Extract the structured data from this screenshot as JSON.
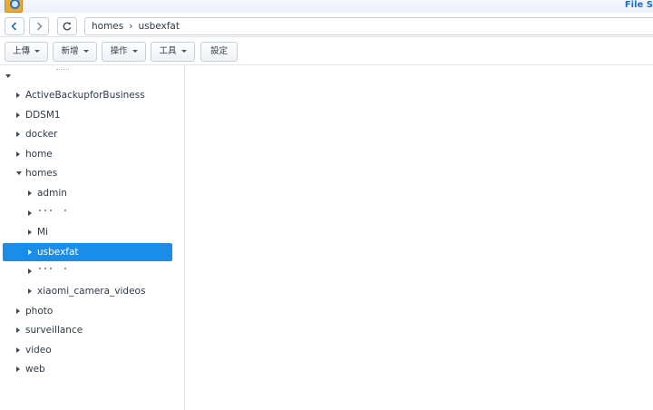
{
  "app": {
    "title": "File S"
  },
  "nav": {
    "back_icon": "chevron-left-icon",
    "forward_icon": "chevron-right-icon",
    "refresh_icon": "refresh-icon",
    "breadcrumb": [
      "homes",
      "usbexfat"
    ],
    "separator": "›"
  },
  "toolbar": {
    "upload_label": "上傳",
    "create_label": "新增",
    "action_label": "操作",
    "tools_label": "工具",
    "settings_label": "設定"
  },
  "tree": {
    "items": [
      {
        "label": "ActiveBackupforBusiness",
        "level": 1,
        "expanded": false
      },
      {
        "label": "DDSM1",
        "level": 1,
        "expanded": false
      },
      {
        "label": "docker",
        "level": 1,
        "expanded": false
      },
      {
        "label": "home",
        "level": 1,
        "expanded": false
      },
      {
        "label": "homes",
        "level": 1,
        "expanded": true
      },
      {
        "label": "admin",
        "level": 2,
        "expanded": false
      },
      {
        "label": "",
        "level": 2,
        "expanded": false,
        "obscured": true
      },
      {
        "label": "Mi",
        "level": 2,
        "expanded": false
      },
      {
        "label": "usbexfat",
        "level": 2,
        "expanded": false,
        "selected": true
      },
      {
        "label": "",
        "level": 2,
        "expanded": false,
        "obscured": true
      },
      {
        "label": "xiaomi_camera_videos",
        "level": 2,
        "expanded": false
      },
      {
        "label": "photo",
        "level": 1,
        "expanded": false
      },
      {
        "label": "surveillance",
        "level": 1,
        "expanded": false
      },
      {
        "label": "video",
        "level": 1,
        "expanded": false
      },
      {
        "label": "web",
        "level": 1,
        "expanded": false
      }
    ]
  },
  "colors": {
    "accent": "#1a8de8",
    "title": "#1f6fc4"
  }
}
